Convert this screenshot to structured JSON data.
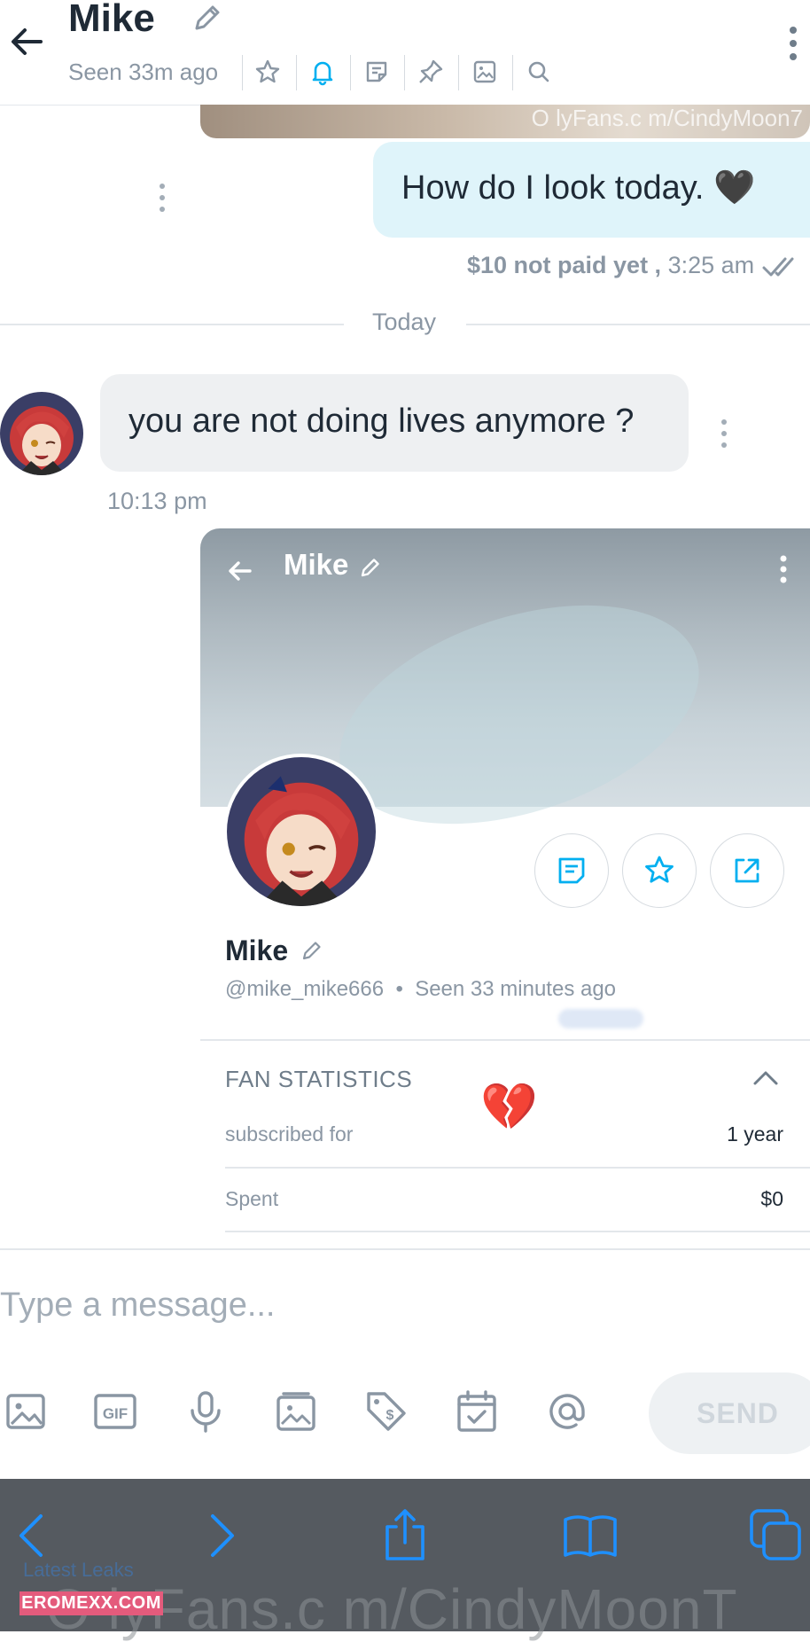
{
  "header": {
    "title": "Mike",
    "seen": "Seen 33m ago"
  },
  "messages": {
    "image_watermark": "O lyFans.c m/CindyMoon7",
    "outgoing_text": "How do I look today. 🖤",
    "outgoing_price": "$10 not paid yet ,",
    "outgoing_time": "3:25 am",
    "day_divider": "Today",
    "incoming_text": "you are not doing lives anymore ?",
    "incoming_time": "10:13 pm"
  },
  "profile_card": {
    "title": "Mike",
    "name": "Mike",
    "handle": "@mike_mike666",
    "separator": "•",
    "seen": "Seen  33 minutes ago",
    "stats_title": "FAN STATISTICS",
    "rows": [
      {
        "label": "subscribed for",
        "value": "1 year"
      },
      {
        "label": "Spent",
        "value": "$0"
      }
    ]
  },
  "overlay": {
    "heart_emoji": "💔"
  },
  "composer": {
    "placeholder": "Type a message...",
    "send_label": "SEND"
  },
  "footer": {
    "watermark": "O lyFans.c m/CindyMoonT",
    "site_badge": "EROMEXX.COM",
    "link_text": "Latest Leaks"
  },
  "colors": {
    "accent": "#00aff0",
    "muted": "#8a96a3",
    "bubble_out": "#dff4fa",
    "bubble_in": "#eef0f2",
    "browser_bar": "#555a60",
    "browser_icon": "#1e90ff"
  }
}
